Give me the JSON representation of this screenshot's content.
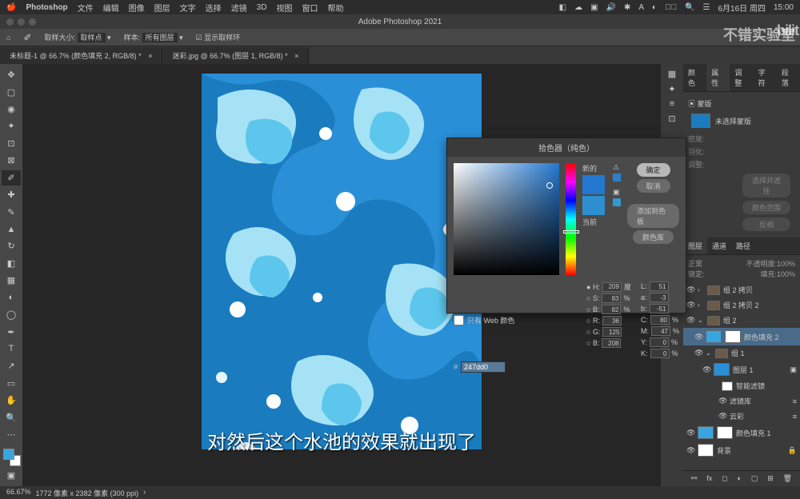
{
  "app_name": "Photoshop",
  "mac_menu": [
    "文件",
    "编辑",
    "图像",
    "图层",
    "文字",
    "选择",
    "滤镜",
    "3D",
    "视图",
    "窗口",
    "帮助"
  ],
  "mac_right": [
    "6月16日 周四",
    "15:00"
  ],
  "window_title": "Adobe Photoshop 2021",
  "options_bar": {
    "sample_size": "取样大小:",
    "sample": "取样点",
    "sample_mode": "样本:",
    "all_layers": "所有图层",
    "show_ring": "显示取样环"
  },
  "tabs": [
    "未标题-1 @ 66.7% (颜色填充 2, RGB/8) *",
    "迷彩.jpg @ 66.7% (图层 1, RGB/8) *"
  ],
  "panels": {
    "tabs_top": [
      "颜色",
      "属性",
      "调整",
      "字符",
      "段落"
    ],
    "mask_title": "蒙版",
    "no_mask": "未选择蒙版",
    "density": "密度:",
    "feather": "羽化:",
    "refine": "调整:",
    "select_subject": "选择并遮住",
    "color_range": "颜色范围",
    "invert": "反相"
  },
  "layers": {
    "tabs": [
      "图层",
      "通道",
      "路径"
    ],
    "blend": "正常",
    "opacity_label": "不透明度:",
    "opacity": "100%",
    "lock_label": "锁定:",
    "fill_label": "填充:",
    "fill": "100%",
    "items": [
      "组 2 拷贝",
      "组 2 拷贝 2",
      "组 2",
      "组 1",
      "颜色填充 2",
      "图层 1",
      "智能滤镜",
      "滤镜库",
      "云彩",
      "颜色填充 1",
      "背景"
    ]
  },
  "color_picker": {
    "title": "拾色器（纯色）",
    "new_label": "新的",
    "current_label": "当前",
    "ok": "确定",
    "cancel": "取消",
    "add_swatch": "添加到色板",
    "libraries": "颜色库",
    "web_only": "只有 Web 颜色",
    "H": "209",
    "S": "83",
    "B": "82",
    "R": "36",
    "G": "125",
    "Bb": "208",
    "L": "51",
    "a": "-3",
    "b": "-51",
    "C": "80",
    "M": "47",
    "Y": "0",
    "K": "0",
    "hex": "247dd0",
    "deg": "度",
    "pct": "%"
  },
  "status": {
    "zoom": "66.67%",
    "info": "1772 像素 x 2382 像素 (300 ppi)"
  },
  "subtitle": "对然后这个水池的效果就出现了",
  "watermark": "不错实验室"
}
